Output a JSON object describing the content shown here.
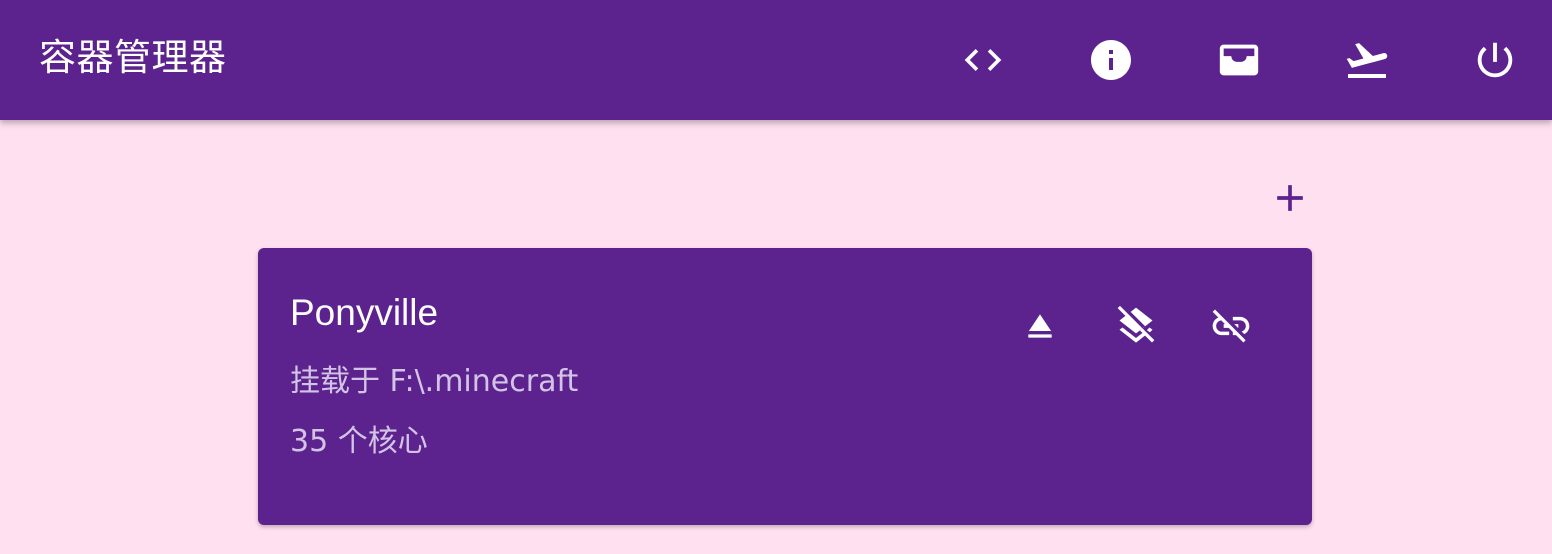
{
  "appbar": {
    "title": "容器管理器",
    "actions": [
      {
        "name": "code-icon"
      },
      {
        "name": "info-icon"
      },
      {
        "name": "inbox-icon"
      },
      {
        "name": "flight-takeoff-icon"
      },
      {
        "name": "power-icon"
      }
    ]
  },
  "toolbar": {
    "add_icon": "add-icon"
  },
  "containers": [
    {
      "name": "Ponyville",
      "mount_text": "挂载于 F:\\.minecraft",
      "cores_text": "35 个核心",
      "actions": [
        {
          "name": "eject-icon"
        },
        {
          "name": "layers-off-icon"
        },
        {
          "name": "link-off-icon"
        }
      ]
    }
  ],
  "colors": {
    "primary": "#5c238f",
    "background": "#ffe0f0",
    "on_primary": "#ffffff",
    "secondary_text": "#d3c4e6"
  }
}
